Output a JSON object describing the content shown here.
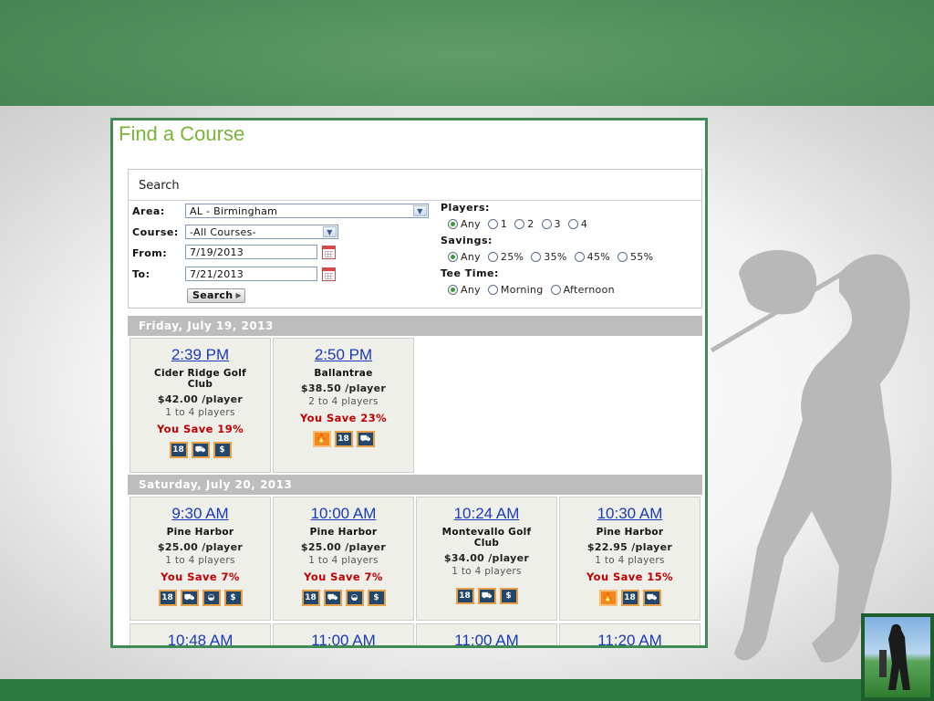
{
  "page": {
    "title": "Find a Course"
  },
  "search": {
    "heading": "Search",
    "area_label": "Area:",
    "area_value": "AL - Birmingham",
    "course_label": "Course:",
    "course_value": "-All Courses-",
    "from_label": "From:",
    "from_value": "7/19/2013",
    "to_label": "To:",
    "to_value": "7/21/2013",
    "search_button": "Search",
    "players_label": "Players:",
    "players_options": [
      "Any",
      "1",
      "2",
      "3",
      "4"
    ],
    "players_selected": "Any",
    "savings_label": "Savings:",
    "savings_options": [
      "Any",
      "25%",
      "35%",
      "45%",
      "55%"
    ],
    "savings_selected": "Any",
    "teetime_label": "Tee Time:",
    "teetime_options": [
      "Any",
      "Morning",
      "Afternoon"
    ],
    "teetime_selected": "Any"
  },
  "days": [
    {
      "label": "Friday, July 19, 2013",
      "slots": [
        {
          "time": "2:39 PM",
          "course": "Cider Ridge Golf Club",
          "price": "$42.00 /player",
          "players": "1 to 4 players",
          "save": "You Save 19%",
          "icons": [
            "18",
            "cart-icon",
            "$"
          ]
        },
        {
          "time": "2:50 PM",
          "course": "Ballantrae",
          "price": "$38.50 /player",
          "players": "2 to 4 players",
          "save": "You Save 23%",
          "icons": [
            "fire-icon",
            "18",
            "cart-icon"
          ]
        }
      ]
    },
    {
      "label": "Saturday, July 20, 2013",
      "slots": [
        {
          "time": "9:30 AM",
          "course": "Pine Harbor",
          "price": "$25.00 /player",
          "players": "1 to 4 players",
          "save": "You Save 7%",
          "icons": [
            "18",
            "cart-icon",
            "bucket-icon",
            "$"
          ]
        },
        {
          "time": "10:00 AM",
          "course": "Pine Harbor",
          "price": "$25.00 /player",
          "players": "1 to 4 players",
          "save": "You Save 7%",
          "icons": [
            "18",
            "cart-icon",
            "bucket-icon",
            "$"
          ]
        },
        {
          "time": "10:24 AM",
          "course": "Montevallo Golf Club",
          "price": "$34.00 /player",
          "players": "1 to 4 players",
          "save": "",
          "icons": [
            "18",
            "cart-icon",
            "$"
          ]
        },
        {
          "time": "10:30 AM",
          "course": "Pine Harbor",
          "price": "$22.95 /player",
          "players": "1 to 4 players",
          "save": "You Save 15%",
          "icons": [
            "fire-icon",
            "18",
            "cart-icon"
          ]
        }
      ]
    }
  ],
  "more_times": [
    "10:48 AM",
    "11:00 AM",
    "11:00 AM",
    "11:20 AM"
  ]
}
